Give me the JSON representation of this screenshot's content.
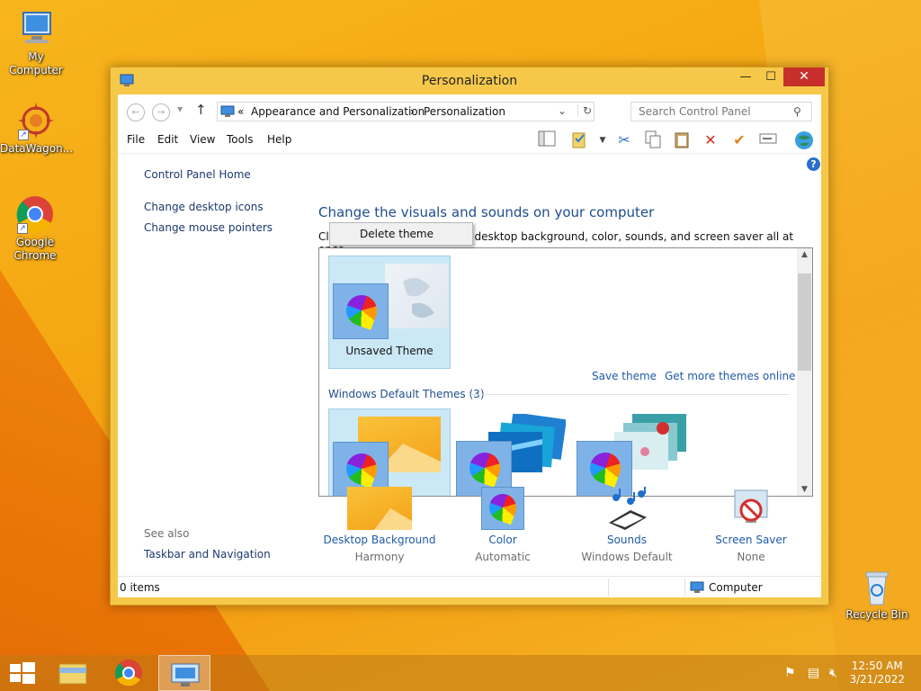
{
  "desktop": {
    "icons": [
      {
        "label": "My Computer"
      },
      {
        "label": "DataWagon..."
      },
      {
        "label": "Google Chrome"
      },
      {
        "label": "Recycle Bin"
      }
    ]
  },
  "window": {
    "title": "Personalization",
    "controls": {
      "minimize": "—",
      "maximize": "☐",
      "close": "✕"
    },
    "address": {
      "prefix": "«",
      "crumb1": "Appearance and Personalization",
      "sep": "›",
      "crumb2": "Personalization"
    },
    "search": {
      "placeholder": "Search Control Panel"
    },
    "menu": [
      "File",
      "Edit",
      "View",
      "Tools",
      "Help"
    ]
  },
  "left_pane": {
    "home": "Control Panel Home",
    "links": [
      "Change desktop icons",
      "Change mouse pointers"
    ],
    "see_also_title": "See also",
    "see_also": [
      "Taskbar and Navigation"
    ]
  },
  "main": {
    "heading": "Change the visuals and sounds on your computer",
    "subtext": "Click a theme to change the desktop background, color, sounds, and screen saver all at once.",
    "context_menu": {
      "item": "Delete theme"
    },
    "unsaved_theme": "Unsaved Theme",
    "save_theme": "Save theme",
    "get_more": "Get more themes online",
    "group_title": "Windows Default Themes (3)"
  },
  "bottom": {
    "items": [
      {
        "label": "Desktop Background",
        "value": "Harmony"
      },
      {
        "label": "Color",
        "value": "Automatic"
      },
      {
        "label": "Sounds",
        "value": "Windows Default"
      },
      {
        "label": "Screen Saver",
        "value": "None"
      }
    ]
  },
  "status": {
    "items": "0 items",
    "location": "Computer"
  },
  "taskbar": {
    "time": "12:50 AM",
    "date": "3/21/2022"
  },
  "colors": {
    "accent": "#f6c84a",
    "close": "#c7302a",
    "link": "#1e5aa8"
  }
}
